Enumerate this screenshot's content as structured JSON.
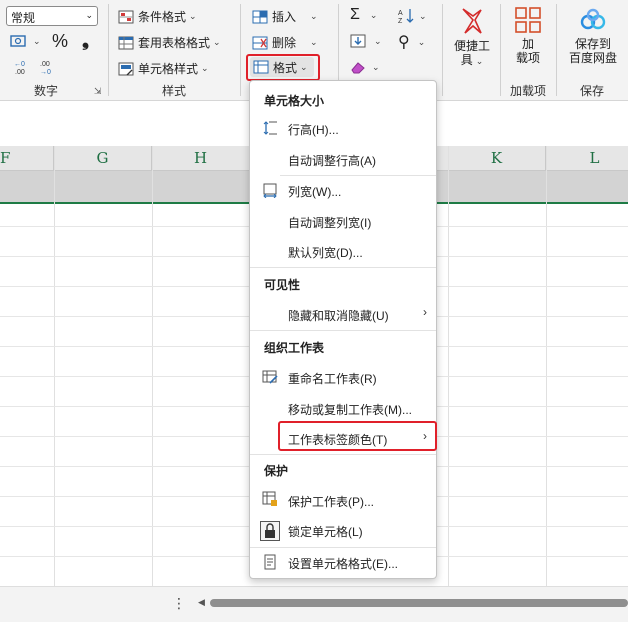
{
  "ribbon": {
    "number_format": "常规",
    "number_group_label": "数字",
    "styles": {
      "conditional_formatting": "条件格式",
      "format_as_table": "套用表格格式",
      "cell_styles": "单元格样式",
      "group_label": "样式"
    },
    "cells": {
      "insert": "插入",
      "delete": "删除",
      "format": "格式"
    },
    "tools": {
      "quick_tools_line1": "便捷工",
      "quick_tools_line2": "具",
      "addins_line1": "加",
      "addins_line2": "载项",
      "addins_group_label": "加载项",
      "save_line1": "保存到",
      "save_line2": "百度网盘",
      "save_group_label": "保存"
    }
  },
  "grid": {
    "columns": [
      "F",
      "G",
      "H",
      "K",
      "L"
    ]
  },
  "menu": {
    "sections": {
      "cell_size": "单元格大小",
      "visibility": "可见性",
      "organize": "组织工作表",
      "protection": "保护"
    },
    "items": {
      "row_height": "行高(H)...",
      "autofit_row": "自动调整行高(A)",
      "column_width": "列宽(W)...",
      "autofit_column": "自动调整列宽(I)",
      "default_width": "默认列宽(D)...",
      "hide_unhide": "隐藏和取消隐藏(U)",
      "rename_sheet": "重命名工作表(R)",
      "move_copy": "移动或复制工作表(M)...",
      "tab_color": "工作表标签颜色(T)",
      "protect_sheet": "保护工作表(P)...",
      "lock_cell": "锁定单元格(L)",
      "format_cells": "设置单元格格式(E)..."
    }
  },
  "colors": {
    "accent_green": "#1e7b45",
    "highlight_red": "#e0202a"
  }
}
